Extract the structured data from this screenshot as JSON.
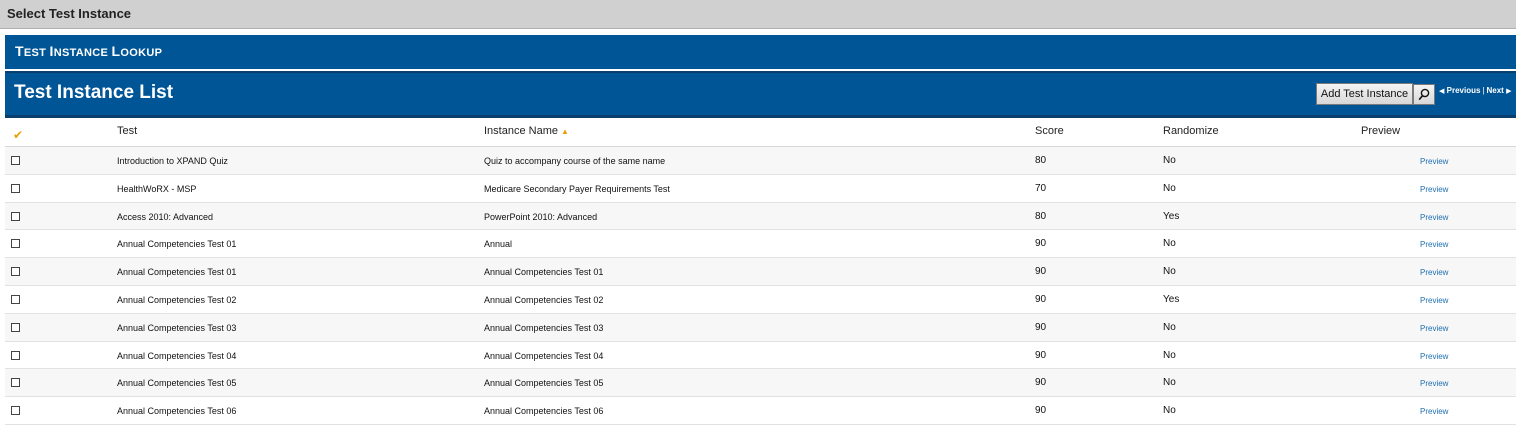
{
  "window_title": "Select Test Instance",
  "lookup_bar": {
    "first": "T",
    "rest": "est ",
    "first2": "I",
    "rest2": "nstance ",
    "first3": "L",
    "rest3": "ookup"
  },
  "list": {
    "title": "Test Instance List",
    "add_button": "Add Test Instance",
    "pager": {
      "previous": "Previous",
      "separator": "|",
      "next": "Next"
    }
  },
  "table": {
    "headers": {
      "check": "✔",
      "test": "Test",
      "instance_name": "Instance Name",
      "score": "Score",
      "randomize": "Randomize",
      "preview": "Preview"
    },
    "sort_indicator": "▲",
    "rows": [
      {
        "test": "Introduction to XPAND Quiz",
        "instance": "Quiz to accompany course of the same name",
        "score": "80",
        "randomize": "No",
        "preview": "Preview"
      },
      {
        "test": "HealthWoRX - MSP",
        "instance": "Medicare Secondary Payer Requirements Test",
        "score": "70",
        "randomize": "No",
        "preview": "Preview"
      },
      {
        "test": "Access 2010: Advanced",
        "instance": "PowerPoint 2010: Advanced",
        "score": "80",
        "randomize": "Yes",
        "preview": "Preview"
      },
      {
        "test": "Annual Competencies Test 01",
        "instance": "Annual",
        "score": "90",
        "randomize": "No",
        "preview": "Preview"
      },
      {
        "test": "Annual Competencies Test 01",
        "instance": "Annual Competencies Test 01",
        "score": "90",
        "randomize": "No",
        "preview": "Preview"
      },
      {
        "test": "Annual Competencies Test 02",
        "instance": "Annual Competencies Test 02",
        "score": "90",
        "randomize": "Yes",
        "preview": "Preview"
      },
      {
        "test": "Annual Competencies Test 03",
        "instance": "Annual Competencies Test 03",
        "score": "90",
        "randomize": "No",
        "preview": "Preview"
      },
      {
        "test": "Annual Competencies Test 04",
        "instance": "Annual Competencies Test 04",
        "score": "90",
        "randomize": "No",
        "preview": "Preview"
      },
      {
        "test": "Annual Competencies Test 05",
        "instance": "Annual Competencies Test 05",
        "score": "90",
        "randomize": "No",
        "preview": "Preview"
      },
      {
        "test": "Annual Competencies Test 06",
        "instance": "Annual Competencies Test 06",
        "score": "90",
        "randomize": "No",
        "preview": "Preview"
      }
    ]
  },
  "colors": {
    "header_blue": "#005596",
    "accent_orange": "#e8a000",
    "link_blue": "#1f6fb2",
    "title_gray": "#d0d0d0"
  },
  "icons": {
    "search": "magnifier-icon",
    "check": "checkmark-icon",
    "prev": "triangle-left-icon",
    "next": "triangle-right-icon"
  }
}
